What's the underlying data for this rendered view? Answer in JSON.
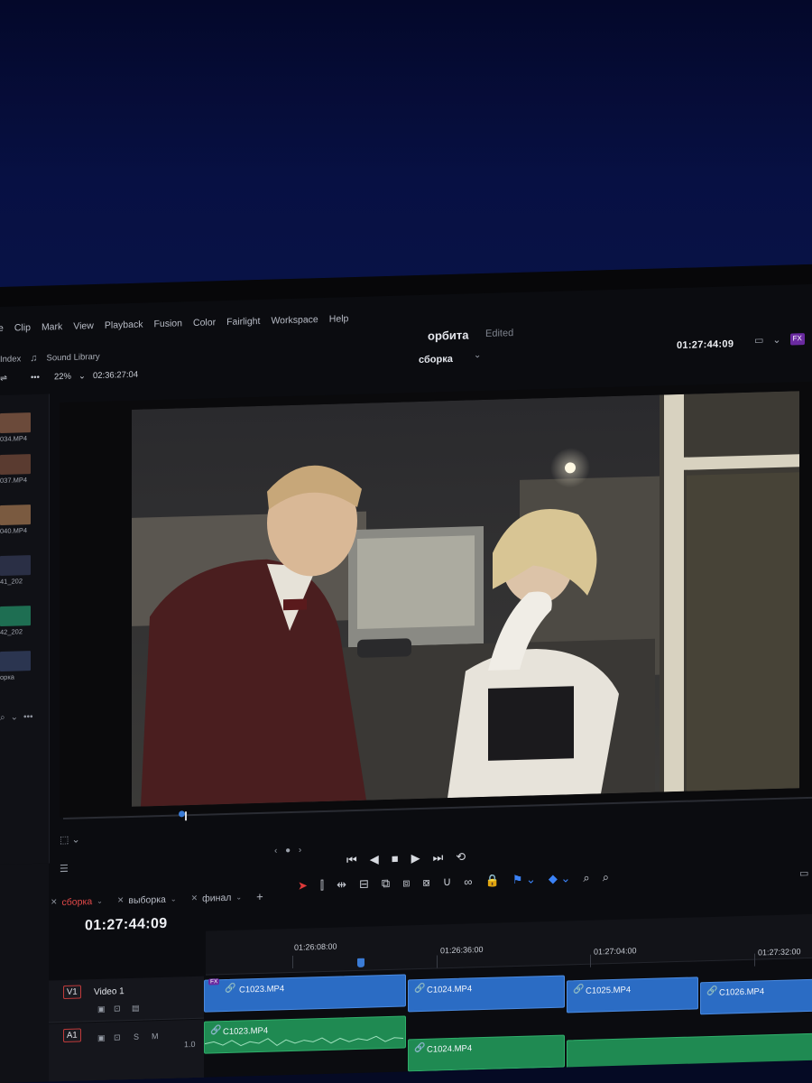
{
  "menu": [
    "e",
    "Clip",
    "Mark",
    "View",
    "Playback",
    "Fusion",
    "Color",
    "Fairlight",
    "Workspace",
    "Help"
  ],
  "toolbar": {
    "index": "Index",
    "sound_library": "Sound Library"
  },
  "viewer_bar": {
    "zoom": "22%",
    "source_timecode": "02:36:27:04"
  },
  "project": {
    "name": "орбита",
    "status": "Edited",
    "timeline": "сборка"
  },
  "record_timecode": "01:27:44:09",
  "media_pool": [
    {
      "label": "034.MP4",
      "color": "#6b4a3a"
    },
    {
      "label": "037.MP4",
      "color": "#5a3b30"
    },
    {
      "label": "040.MP4",
      "color": "#7a5a40"
    },
    {
      "label": "41_202",
      "color": "#2a2f45"
    },
    {
      "label": "42_202",
      "color": "#1e6e52"
    },
    {
      "label": "орка",
      "color": "#2b3550"
    }
  ],
  "tabs": [
    {
      "label": "сборка",
      "active": true
    },
    {
      "label": "выборка",
      "active": false
    },
    {
      "label": "финал",
      "active": false
    }
  ],
  "timeline": {
    "timecode": "01:27:44:09",
    "ruler": [
      "01:26:08:00",
      "01:26:36:00",
      "01:27:04:00",
      "01:27:32:00"
    ],
    "tracks": {
      "v1": {
        "badge": "V1",
        "name": "Video 1"
      },
      "a1": {
        "badge": "A1",
        "level": "1.0"
      }
    },
    "video_clips": [
      "C1023.MP4",
      "C1024.MP4",
      "C1025.MP4",
      "C1026.MP4"
    ],
    "audio_clips": [
      "C1023.MP4",
      "C1024.MP4"
    ]
  },
  "icons": {
    "fx_badge": "FX",
    "colors": {
      "accent_blue": "#2b6cc4",
      "audio_green": "#1f8a52",
      "active_red": "#e04848"
    }
  }
}
